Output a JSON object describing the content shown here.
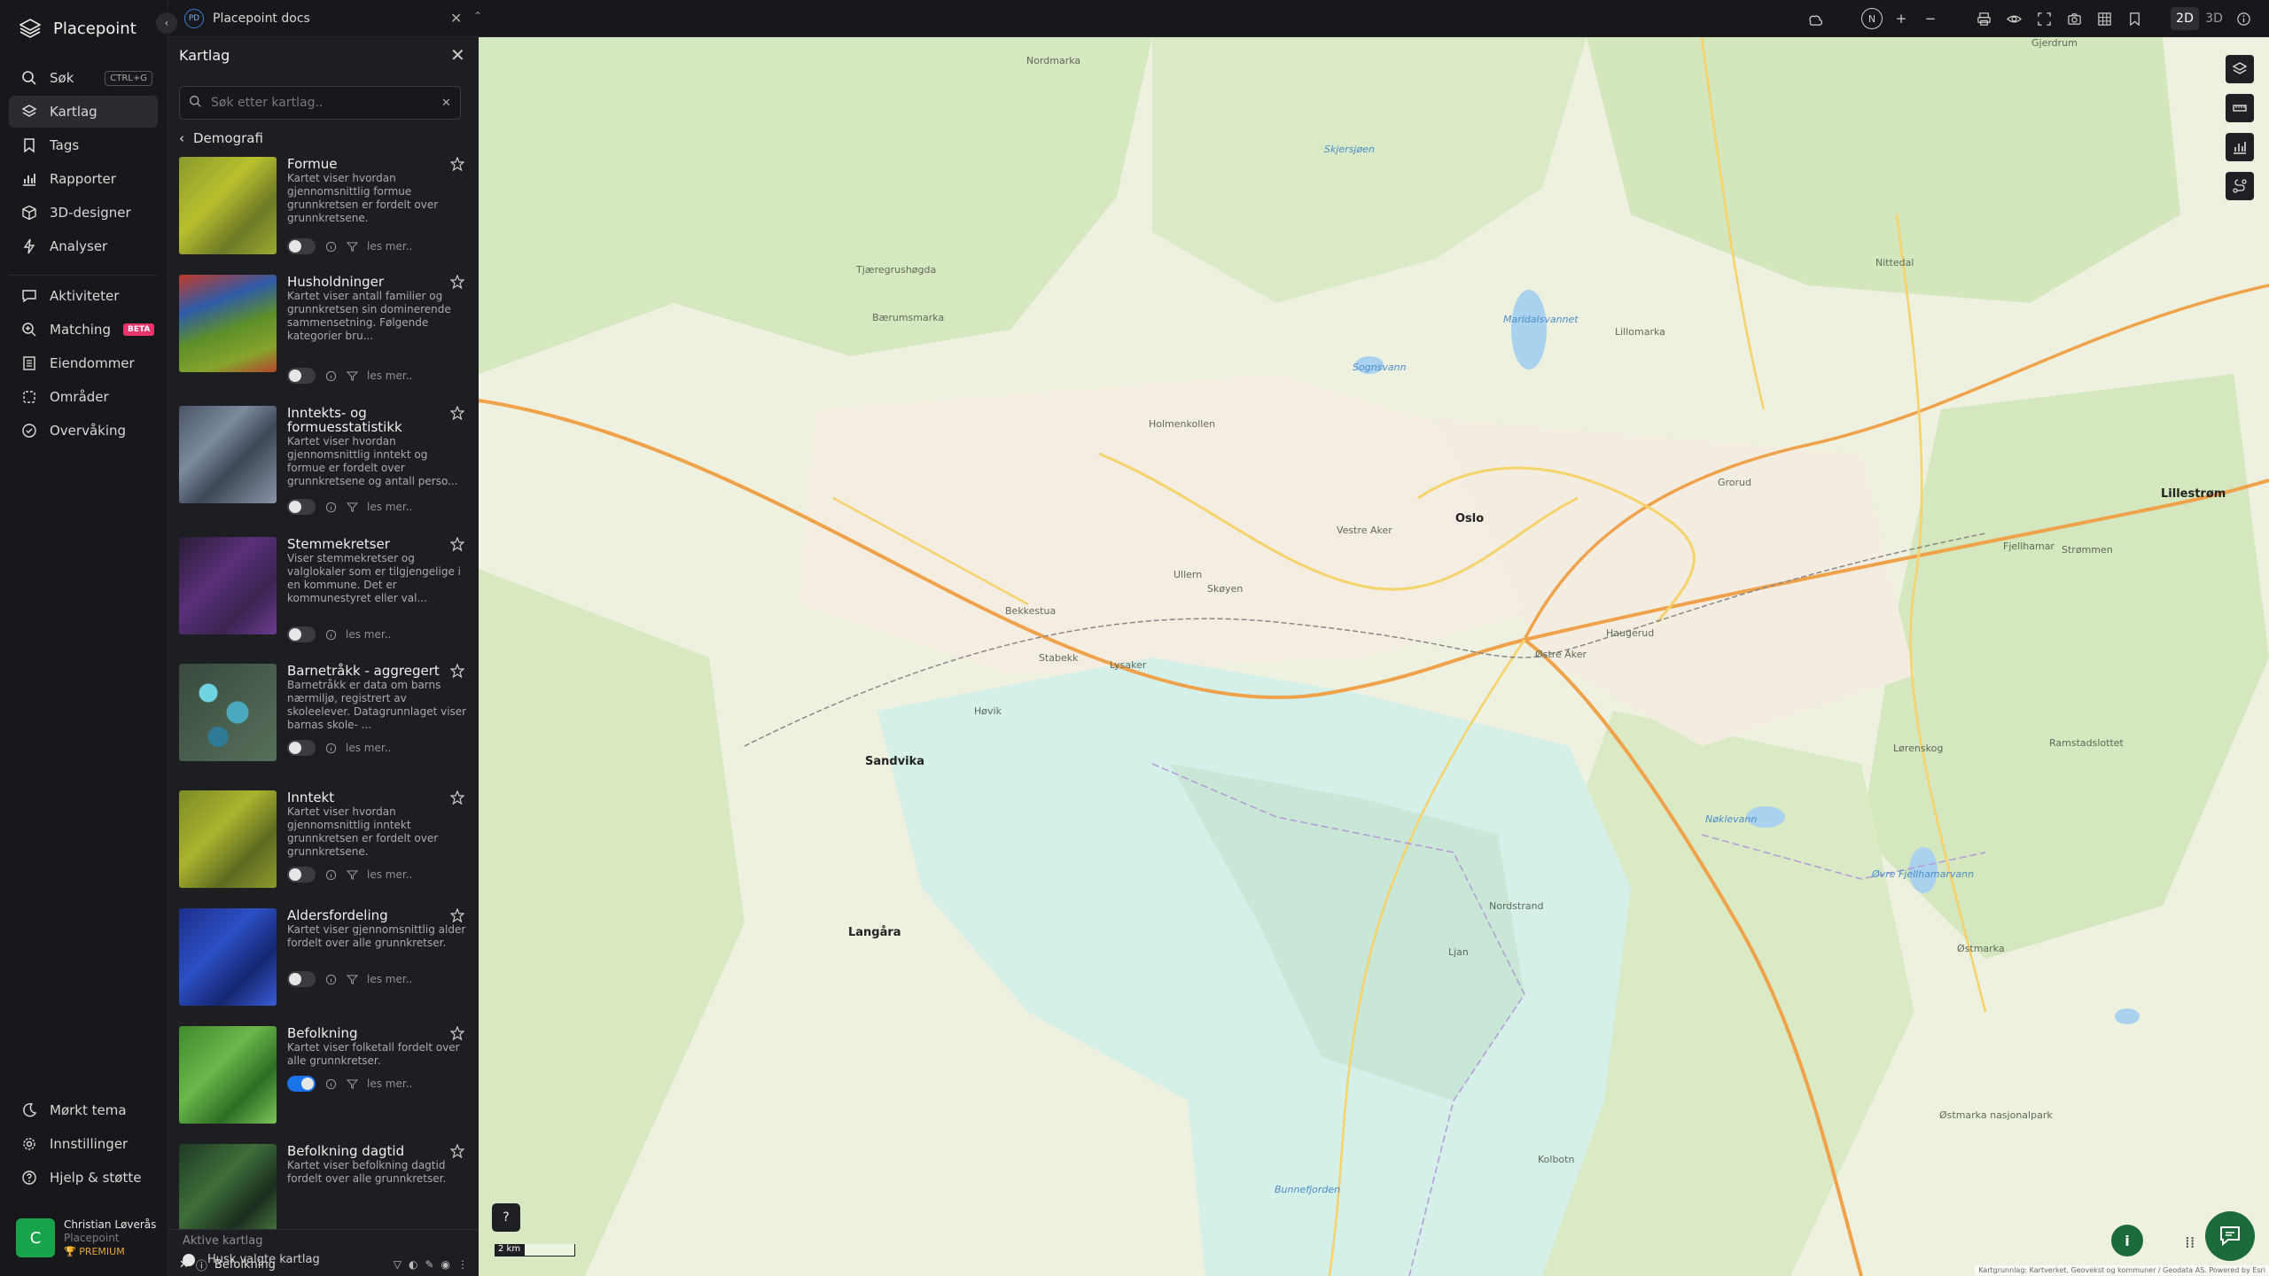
{
  "app": {
    "name": "Placepoint"
  },
  "nav": {
    "items": [
      {
        "label": "Søk",
        "shortcut": "CTRL+G"
      },
      {
        "label": "Kartlag"
      },
      {
        "label": "Tags"
      },
      {
        "label": "Rapporter"
      },
      {
        "label": "3D-designer"
      },
      {
        "label": "Analyser"
      },
      {
        "label": "Aktiviteter"
      },
      {
        "label": "Matching",
        "badge": "BETA"
      },
      {
        "label": "Eiendommer"
      },
      {
        "label": "Områder"
      },
      {
        "label": "Overvåking"
      }
    ],
    "bottom": [
      {
        "label": "Mørkt tema"
      },
      {
        "label": "Innstillinger"
      },
      {
        "label": "Hjelp & støtte"
      }
    ],
    "user": {
      "initial": "C",
      "name": "Christian Løverås",
      "org": "Placepoint",
      "tier": "PREMIUM"
    }
  },
  "topbar": {
    "doc_badge": "PD",
    "doc_title": "Placepoint docs",
    "compass": "N",
    "zoom_in": "+",
    "zoom_out": "−",
    "mode_2d": "2D",
    "mode_3d": "3D"
  },
  "panel": {
    "title": "Kartlag",
    "search_placeholder": "Søk etter kartlag..",
    "breadcrumb": "Demografi",
    "read_more": "les mer..",
    "layers": [
      {
        "name": "Formue",
        "desc": "Kartet viser hvordan gjennomsnittlig formue grunnkretsen er fordelt over grunnkretsene.",
        "enabled": false
      },
      {
        "name": "Husholdninger",
        "desc": "Kartet viser antall familier og grunnkretsen sin dominerende sammensetning. Følgende kategorier bru...",
        "enabled": false
      },
      {
        "name": "Inntekts- og formuesstatistikk",
        "desc": "Kartet viser hvordan gjennomsnittlig inntekt og formue er fordelt over grunnkretsene og antall perso...",
        "enabled": false
      },
      {
        "name": "Stemmekretser",
        "desc": "Viser stemmekretser og valglokaler som er tilgjengelige i en kommune. Det er kommunestyret eller val...",
        "enabled": false
      },
      {
        "name": "Barnetråkk - aggregert",
        "desc": "Barnetråkk er data om barns nærmiljø, registrert av skoleelever. Datagrunnlaget viser barnas skole- ...",
        "enabled": false
      },
      {
        "name": "Inntekt",
        "desc": "Kartet viser hvordan gjennomsnittlig inntekt grunnkretsen er fordelt over grunnkretsene.",
        "enabled": false
      },
      {
        "name": "Aldersfordeling",
        "desc": "Kartet viser gjennomsnittlig alder fordelt over alle grunnkretser.",
        "enabled": false
      },
      {
        "name": "Befolkning",
        "desc": "Kartet viser folketall fordelt over alle grunnkretser.",
        "enabled": true
      },
      {
        "name": "Befolkning dagtid",
        "desc": "Kartet viser befolkning dagtid fordelt over alle grunnkretser.",
        "enabled": false
      }
    ],
    "active_label": "Aktive kartlag",
    "active_layer": "Befolkning",
    "remember_label": "Husk valgte kartlag"
  },
  "map": {
    "scale": "2 km",
    "attribution": "Kartgrunnlag: Kartverket, Geovekst og kommuner / Geodata AS. Powered by Esri",
    "help": "?",
    "info": "i",
    "labels": [
      {
        "text": "Oslo",
        "kind": "city"
      },
      {
        "text": "Sandvika",
        "kind": "city"
      },
      {
        "text": "Lillestrøm",
        "kind": "city"
      },
      {
        "text": "Langåra",
        "kind": "city"
      },
      {
        "text": "Holmenkollen",
        "kind": "place"
      },
      {
        "text": "Bærumsmarka",
        "kind": "place"
      },
      {
        "text": "Tjæregrushøgda",
        "kind": "place"
      },
      {
        "text": "Vestre Aker",
        "kind": "place"
      },
      {
        "text": "Østre Aker",
        "kind": "place"
      },
      {
        "text": "Haugerud",
        "kind": "place"
      },
      {
        "text": "Ramstadslottet",
        "kind": "place"
      },
      {
        "text": "Østmarka",
        "kind": "place"
      },
      {
        "text": "Østmarka nasjonalpark",
        "kind": "place"
      },
      {
        "text": "Kolbotn",
        "kind": "place"
      },
      {
        "text": "Lørenskog",
        "kind": "place"
      },
      {
        "text": "Bekkestua",
        "kind": "place"
      },
      {
        "text": "Høvik",
        "kind": "place"
      },
      {
        "text": "Stabekk",
        "kind": "place"
      },
      {
        "text": "Lysaker",
        "kind": "place"
      },
      {
        "text": "Ullern",
        "kind": "place"
      },
      {
        "text": "Skøyen",
        "kind": "place"
      },
      {
        "text": "Nordstrand",
        "kind": "place"
      },
      {
        "text": "Ljan",
        "kind": "place"
      },
      {
        "text": "Grorud",
        "kind": "place"
      },
      {
        "text": "Fjellhamar",
        "kind": "place"
      },
      {
        "text": "Strømmen",
        "kind": "place"
      },
      {
        "text": "Nittedal",
        "kind": "place"
      },
      {
        "text": "Gjerdrum",
        "kind": "place"
      },
      {
        "text": "Nordmarka",
        "kind": "place"
      },
      {
        "text": "Lillomarka",
        "kind": "place"
      },
      {
        "text": "Maridalsvannet",
        "kind": "water"
      },
      {
        "text": "Sognsvann",
        "kind": "water"
      },
      {
        "text": "Skjersjøen",
        "kind": "water"
      },
      {
        "text": "Nøklevann",
        "kind": "water"
      },
      {
        "text": "Bunnefjorden",
        "kind": "water"
      },
      {
        "text": "Øvre Fjellhamarvann",
        "kind": "water"
      }
    ]
  },
  "colors": {
    "accent": "#1a73e8",
    "brand_green": "#1c6b3a",
    "beta": "#e8336b",
    "premium": "#e3a83a"
  }
}
